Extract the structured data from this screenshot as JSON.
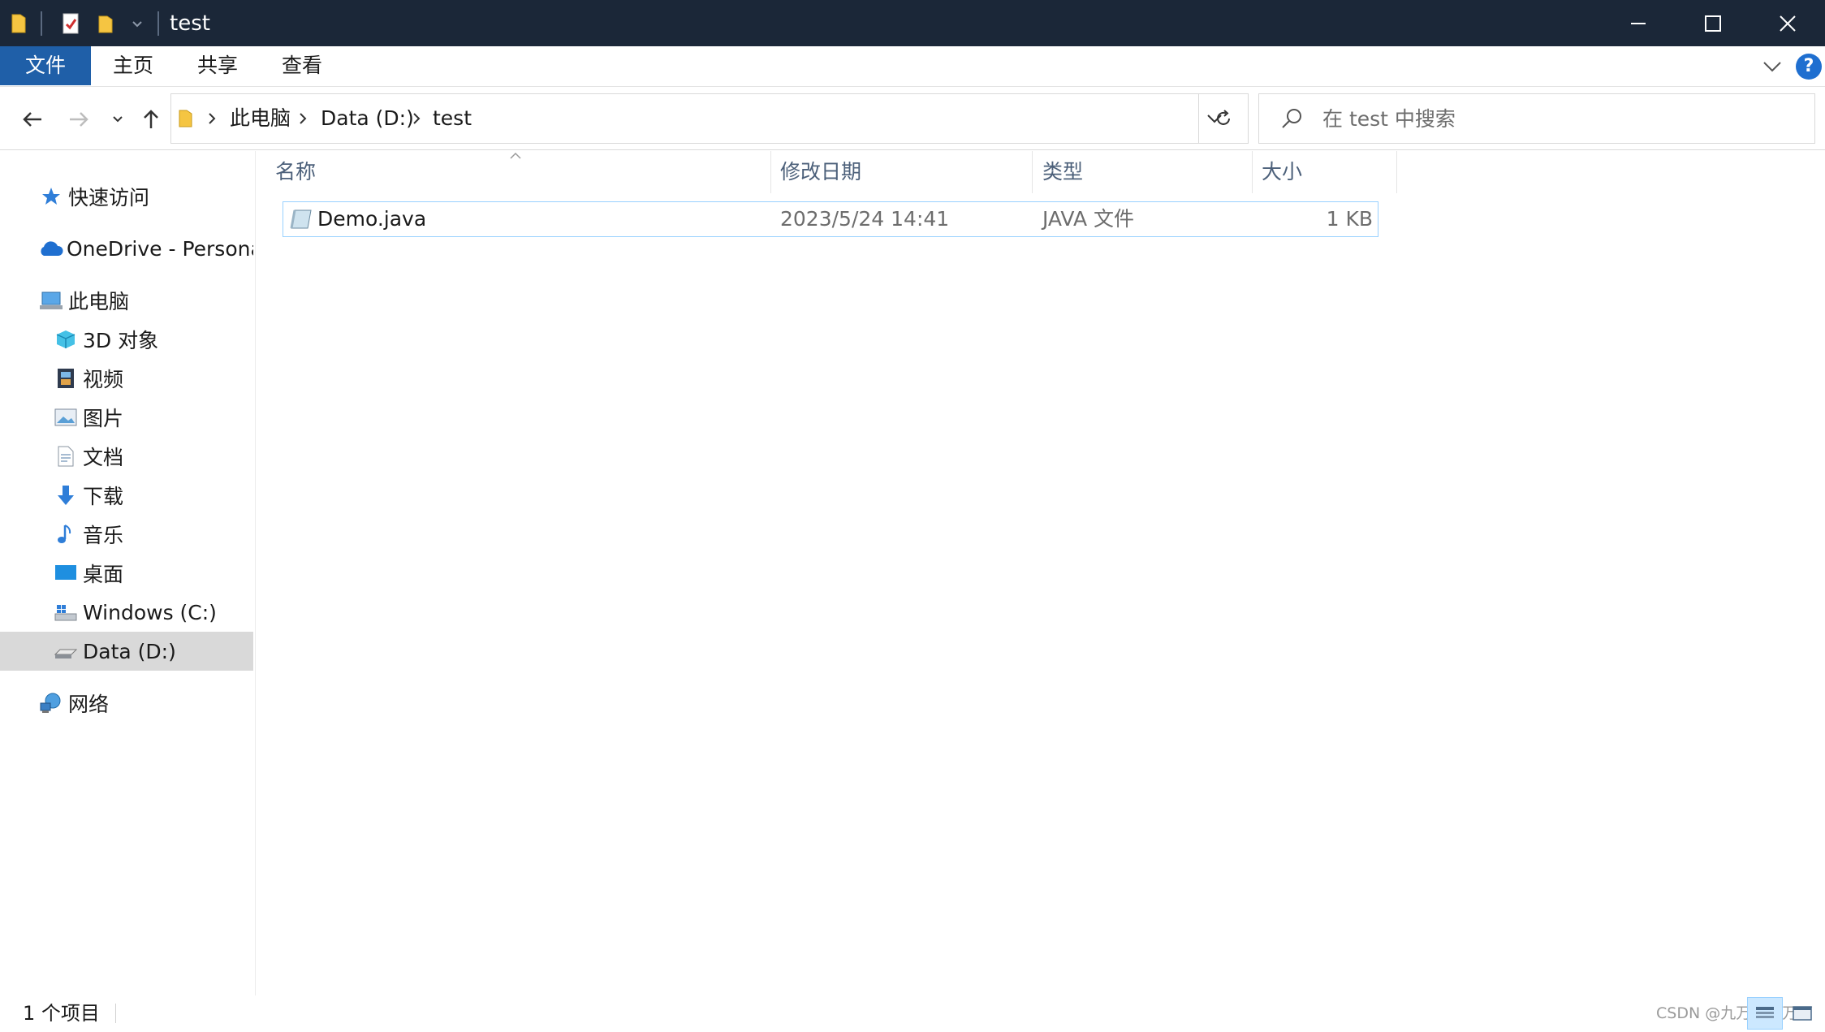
{
  "window": {
    "title": "test",
    "quick_access": [
      "folder-icon",
      "properties-icon",
      "new-folder-icon",
      "customize-dropdown-icon"
    ]
  },
  "ribbon": {
    "tabs": [
      {
        "label": "文件",
        "active": true
      },
      {
        "label": "主页"
      },
      {
        "label": "共享"
      },
      {
        "label": "查看"
      }
    ],
    "help_label": "?"
  },
  "address": {
    "crumbs": [
      "此电脑",
      "Data (D:)",
      "test"
    ]
  },
  "search": {
    "placeholder": "在 test 中搜索"
  },
  "sidebar": {
    "items": [
      {
        "label": "快速访问",
        "icon": "star-icon"
      },
      {
        "label": "OneDrive - Persona",
        "icon": "cloud-icon"
      },
      {
        "label": "此电脑",
        "icon": "computer-icon"
      },
      {
        "label": "3D 对象",
        "icon": "cube-icon"
      },
      {
        "label": "视频",
        "icon": "film-icon"
      },
      {
        "label": "图片",
        "icon": "picture-icon"
      },
      {
        "label": "文档",
        "icon": "document-icon"
      },
      {
        "label": "下载",
        "icon": "download-arrow-icon"
      },
      {
        "label": "音乐",
        "icon": "music-note-icon"
      },
      {
        "label": "桌面",
        "icon": "desktop-icon"
      },
      {
        "label": "Windows (C:)",
        "icon": "windows-drive-icon"
      },
      {
        "label": "Data (D:)",
        "icon": "drive-icon",
        "selected": true
      },
      {
        "label": "网络",
        "icon": "network-icon"
      }
    ]
  },
  "table": {
    "columns": [
      "名称",
      "修改日期",
      "类型",
      "大小"
    ],
    "rows": [
      {
        "name": "Demo.java",
        "modified": "2023/5/24 14:41",
        "type": "JAVA 文件",
        "size": "1 KB"
      }
    ]
  },
  "status": {
    "item_count": "1 个项目",
    "watermark": "CSDN @九万万万万万"
  },
  "colors": {
    "titlebar": "#1b2738",
    "file_tab": "#1f5fa8",
    "selection_border": "#99d1ff",
    "sidebar_selected": "#d9d9d9"
  }
}
